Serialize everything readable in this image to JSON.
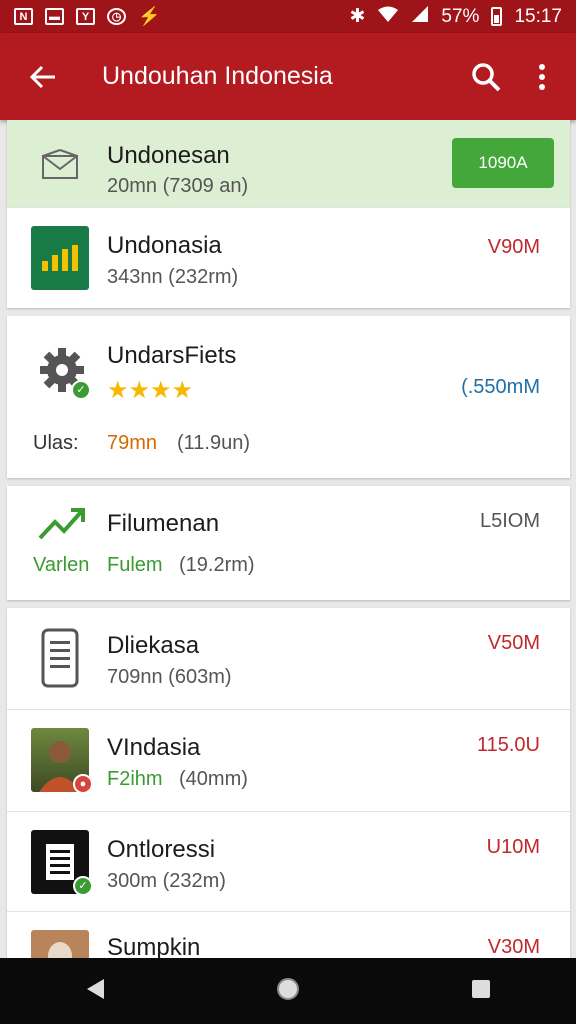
{
  "status_bar": {
    "left_icons": [
      "notification-n-icon",
      "notification-photo-icon",
      "notification-y-icon",
      "notification-clock-icon",
      "notification-bolt-icon"
    ],
    "battery": "57%",
    "time": "15:17"
  },
  "app_bar": {
    "title": "Undouhan Indonesia"
  },
  "items": [
    {
      "name": "Undonesan",
      "meta": "20mn (7309 an)",
      "action": "1090A"
    },
    {
      "name": "Undonasia",
      "meta": "343nn (232rm)",
      "size": "V90M"
    },
    {
      "name": "UndarsFiets",
      "rating": "★★★★",
      "label": "Ulas:",
      "meta_highlight": "79mn",
      "meta": "(11.9un)",
      "size": "(.550mM"
    },
    {
      "name": "Filumenan",
      "label": "Varlen",
      "meta_highlight": "Fulem",
      "meta": "(19.2rm)",
      "size": "L5IOM"
    },
    {
      "name": "Dliekasa",
      "meta": "709nn (603m)",
      "size": "V50M"
    },
    {
      "name": "VIndasia",
      "meta_highlight": "F2ihm",
      "meta": "(40mm)",
      "size": "115.0U"
    },
    {
      "name": "Ontloressi",
      "meta": "300m (232m)",
      "size": "U10M"
    },
    {
      "name": "Sumpkin",
      "size": "V30M"
    }
  ],
  "colors": {
    "primary": "#b31b20",
    "status_bar": "#9e1419",
    "accent_green": "#43a73a",
    "size_red": "#c0282d"
  }
}
